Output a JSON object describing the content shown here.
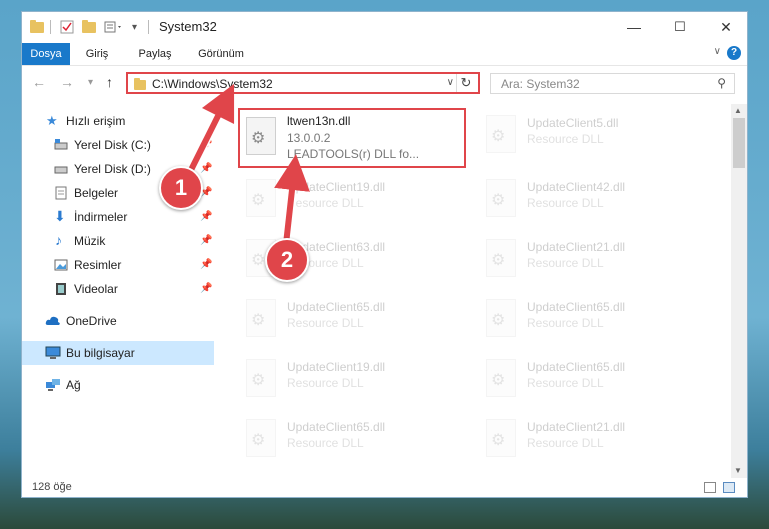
{
  "window": {
    "title": "System32",
    "controls": {
      "minimize": "—",
      "maximize": "☐",
      "close": "✕"
    }
  },
  "ribbon": {
    "tabs": [
      "Dosya",
      "Giriş",
      "Paylaş",
      "Görünüm"
    ],
    "active_tab": "Dosya",
    "help": "?",
    "accent_color": "#1979ca"
  },
  "address": {
    "path": "C:\\Windows\\System32",
    "search_placeholder": "Ara: System32"
  },
  "nav_pane": {
    "items": [
      {
        "label": "Hızlı erişim",
        "icon": "star-icon",
        "pinned": false
      },
      {
        "label": "Yerel Disk (C:)",
        "icon": "drive-icon",
        "pinned": true
      },
      {
        "label": "Yerel Disk (D:)",
        "icon": "drive-icon",
        "pinned": true
      },
      {
        "label": "Belgeler",
        "icon": "documents-icon",
        "pinned": true
      },
      {
        "label": "İndirmeler",
        "icon": "download-icon",
        "pinned": true
      },
      {
        "label": "Müzik",
        "icon": "music-icon",
        "pinned": true
      },
      {
        "label": "Resimler",
        "icon": "pictures-icon",
        "pinned": true
      },
      {
        "label": "Videolar",
        "icon": "videos-icon",
        "pinned": true
      },
      {
        "label": "OneDrive",
        "icon": "cloud-icon",
        "pinned": false
      },
      {
        "label": "Bu bilgisayar",
        "icon": "computer-icon",
        "pinned": false,
        "selected": true
      },
      {
        "label": "Ağ",
        "icon": "network-icon",
        "pinned": false
      }
    ],
    "pin_glyph": "📌"
  },
  "files": {
    "highlighted": {
      "name": "ltwen13n.dll",
      "version": "13.0.0.2",
      "description": "LEADTOOLS(r) DLL fo..."
    },
    "faded_left": [
      {
        "name": "UpdateClient19.dll",
        "type": "Resource DLL"
      },
      {
        "name": "UpdateClient63.dll",
        "type": "Resource DLL"
      },
      {
        "name": "UpdateClient65.dll",
        "type": "Resource DLL"
      },
      {
        "name": "UpdateClient19.dll",
        "type": "Resource DLL"
      },
      {
        "name": "UpdateClient65.dll",
        "type": "Resource DLL"
      },
      {
        "name": "UpdateClient19.dll",
        "type": "Resource DLL"
      }
    ],
    "faded_right": [
      {
        "name": "UpdateClient5.dll",
        "type": "Resource DLL"
      },
      {
        "name": "UpdateClient42.dll",
        "type": "Resource DLL"
      },
      {
        "name": "UpdateClient21.dll",
        "type": "Resource DLL"
      },
      {
        "name": "UpdateClient65.dll",
        "type": "Resource DLL"
      },
      {
        "name": "UpdateClient65.dll",
        "type": "Resource DLL"
      },
      {
        "name": "UpdateClient21.dll",
        "type": "Resource DLL"
      },
      {
        "name": "UpdateClient21.dll",
        "type": "Resource DLL"
      }
    ]
  },
  "status": {
    "item_count": "128 öğe"
  },
  "annotations": {
    "step1": "1",
    "step2": "2",
    "color": "#e0454a"
  }
}
